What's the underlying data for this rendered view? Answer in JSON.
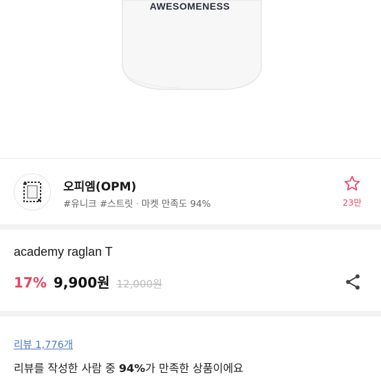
{
  "product_image": {
    "shirt_print_text": "AWESOMENESS"
  },
  "shop": {
    "logo_icon": "shop-logo-frame",
    "name": "오피엠(OPM)",
    "tags": "#유니크 #스트릿",
    "separator": "·",
    "satisfaction": "마켓 만족도 94%",
    "favorite_icon": "star-outline-icon",
    "favorite_count": "23만"
  },
  "product": {
    "name": "academy raglan T",
    "discount": "17%",
    "price": "9,900원",
    "original_price": "12,000원",
    "share_icon": "share-icon"
  },
  "review": {
    "link_label": "리뷰 1,776개",
    "summary_prefix": "리뷰를 작성한 사람 중 ",
    "summary_percent": "94%",
    "summary_suffix": "가 만족한 상품이에요"
  },
  "colors": {
    "accent_pink": "#e8475f",
    "link_blue": "#4a79c8"
  }
}
